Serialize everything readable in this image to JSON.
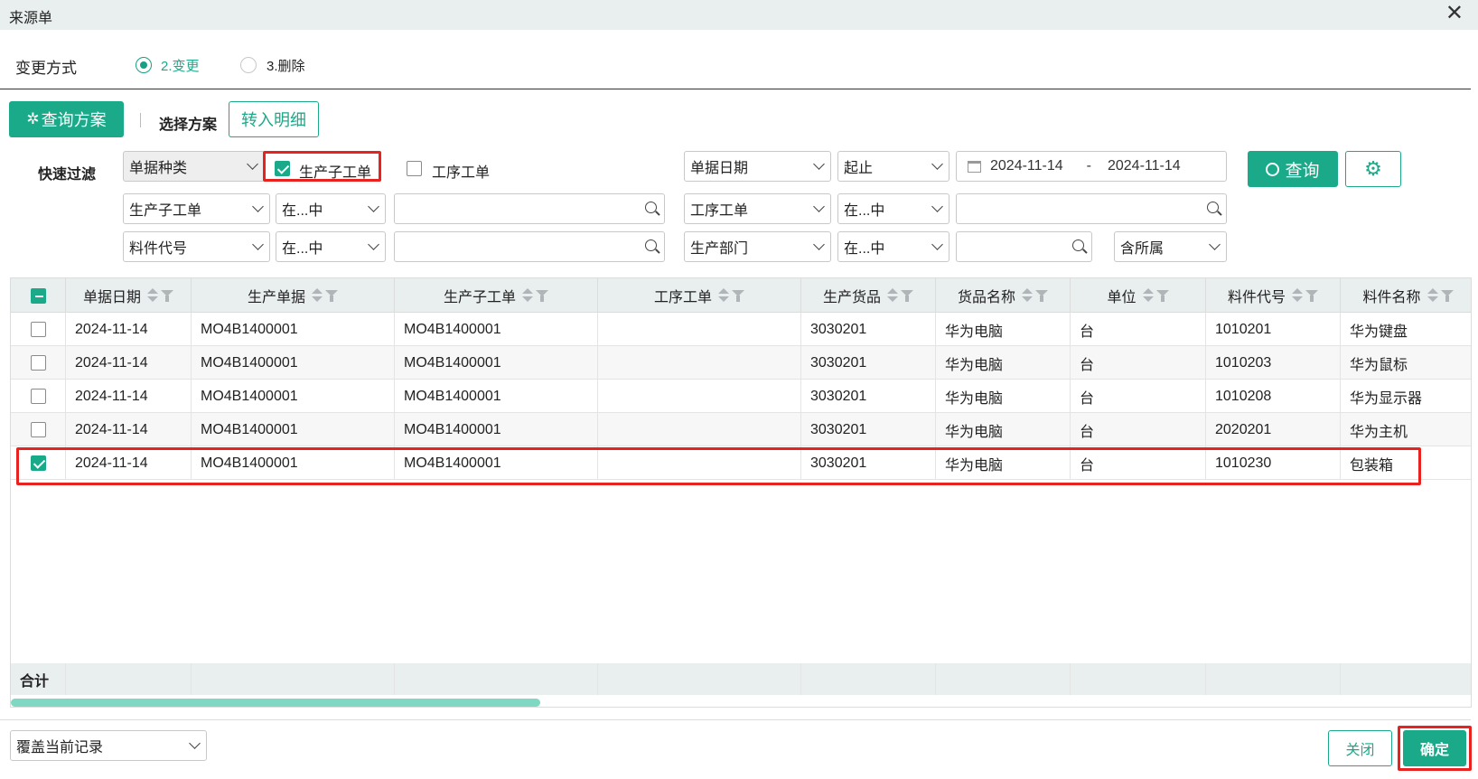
{
  "window": {
    "title": "来源单"
  },
  "mode": {
    "label": "变更方式",
    "options": [
      "2.变更",
      "3.删除"
    ],
    "selected": "2.变更"
  },
  "toolbar": {
    "query_plan": "查询方案",
    "choose_plan": "选择方案",
    "transfer_detail": "转入明细"
  },
  "filter": {
    "label": "快速过滤",
    "doc_type": "单据种类",
    "cb_production_sub": {
      "label": "生产子工单",
      "checked": true
    },
    "cb_process": {
      "label": "工序工单",
      "checked": false
    },
    "date_field": "单据日期",
    "date_mode": "起止",
    "date_from": "2024-11-14",
    "date_sep": "-",
    "date_to": "2024-11-14",
    "row2": {
      "field1": "生产子工单",
      "op1": "在...中",
      "field2": "工序工单",
      "op2": "在...中"
    },
    "row3": {
      "field1": "料件代号",
      "op1": "在...中",
      "field2": "生产部门",
      "op2": "在...中",
      "scope": "含所属"
    },
    "search_btn": "查询"
  },
  "table": {
    "columns": [
      "单据日期",
      "生产单据",
      "生产子工单",
      "工序工单",
      "生产货品",
      "货品名称",
      "单位",
      "料件代号",
      "料件名称"
    ],
    "rows": [
      {
        "checked": false,
        "cells": [
          "2024-11-14",
          "MO4B1400001",
          "MO4B1400001",
          "",
          "3030201",
          "华为电脑",
          "台",
          "1010201",
          "华为键盘"
        ]
      },
      {
        "checked": false,
        "cells": [
          "2024-11-14",
          "MO4B1400001",
          "MO4B1400001",
          "",
          "3030201",
          "华为电脑",
          "台",
          "1010203",
          "华为鼠标"
        ]
      },
      {
        "checked": false,
        "cells": [
          "2024-11-14",
          "MO4B1400001",
          "MO4B1400001",
          "",
          "3030201",
          "华为电脑",
          "台",
          "1010208",
          "华为显示器"
        ]
      },
      {
        "checked": false,
        "cells": [
          "2024-11-14",
          "MO4B1400001",
          "MO4B1400001",
          "",
          "3030201",
          "华为电脑",
          "台",
          "2020201",
          "华为主机"
        ]
      },
      {
        "checked": true,
        "cells": [
          "2024-11-14",
          "MO4B1400001",
          "MO4B1400001",
          "",
          "3030201",
          "华为电脑",
          "台",
          "1010230",
          "包装箱"
        ]
      }
    ],
    "total_label": "合计"
  },
  "footer": {
    "overwrite": "覆盖当前记录",
    "close": "关闭",
    "confirm": "确定"
  },
  "colors": {
    "accent": "#1aaa89",
    "highlight": "#e8231f"
  }
}
